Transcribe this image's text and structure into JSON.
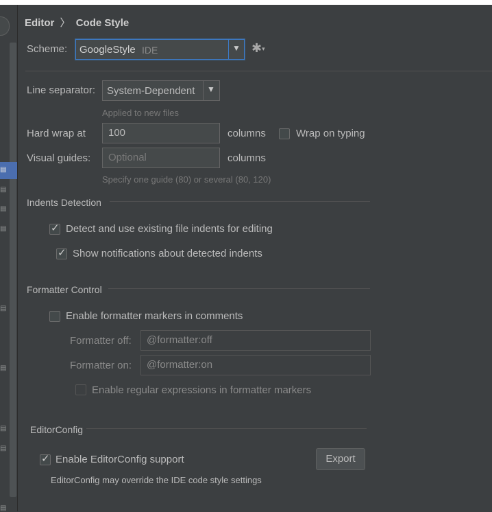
{
  "breadcrumb": {
    "parent": "Editor",
    "separator": "〉",
    "current": "Code Style"
  },
  "scheme": {
    "label": "Scheme:",
    "value": "GoogleStyle",
    "scope": "IDE"
  },
  "line_separator": {
    "label": "Line separator:",
    "value": "System-Dependent",
    "hint": "Applied to new files"
  },
  "hard_wrap": {
    "label": "Hard wrap at",
    "value": "100",
    "unit": "columns",
    "wrap_on_typing": "Wrap on typing",
    "wrap_on_typing_checked": false
  },
  "visual_guides": {
    "label": "Visual guides:",
    "placeholder": "Optional",
    "unit": "columns",
    "hint": "Specify one guide (80) or several (80, 120)"
  },
  "indents": {
    "title": "Indents Detection",
    "detect": {
      "label": "Detect and use existing file indents for editing",
      "checked": true
    },
    "notify": {
      "label": "Show notifications about detected indents",
      "checked": true
    }
  },
  "formatter": {
    "title": "Formatter Control",
    "enable": {
      "label": "Enable formatter markers in comments",
      "checked": false
    },
    "off_label": "Formatter off:",
    "off_value": "@formatter:off",
    "on_label": "Formatter on:",
    "on_value": "@formatter:on",
    "regex": {
      "label": "Enable regular expressions in formatter markers",
      "checked": false
    }
  },
  "editorconfig": {
    "title": "EditorConfig",
    "enable": {
      "label": "Enable EditorConfig support",
      "checked": true
    },
    "export_label": "Export",
    "note": "EditorConfig may override the IDE code style settings"
  },
  "colors": {
    "background": "#3c3f41",
    "field": "#45494a",
    "focus": "#3d7ac6",
    "selection": "#4b6eaf"
  }
}
